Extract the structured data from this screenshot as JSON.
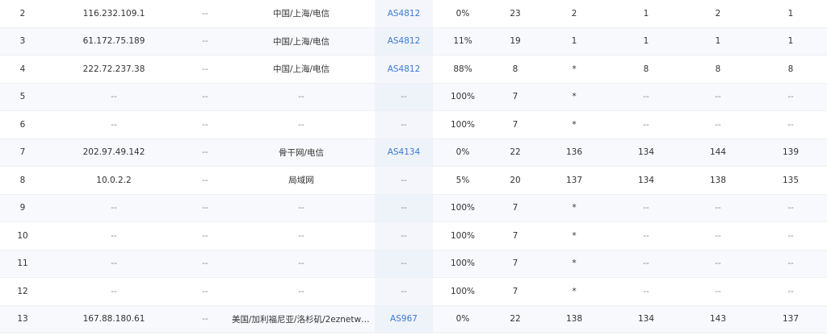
{
  "rows": [
    {
      "hop": "2",
      "ip": "116.232.109.1",
      "host": "--",
      "location": "中国/上海/电信",
      "asn": "AS4812",
      "loss": "0%",
      "sent": "23",
      "last": "2",
      "avg": "1",
      "best": "2",
      "worst": "1"
    },
    {
      "hop": "3",
      "ip": "61.172.75.189",
      "host": "--",
      "location": "中国/上海/电信",
      "asn": "AS4812",
      "loss": "11%",
      "sent": "19",
      "last": "1",
      "avg": "1",
      "best": "1",
      "worst": "1"
    },
    {
      "hop": "4",
      "ip": "222.72.237.38",
      "host": "--",
      "location": "中国/上海/电信",
      "asn": "AS4812",
      "loss": "88%",
      "sent": "8",
      "last": "*",
      "avg": "8",
      "best": "8",
      "worst": "8"
    },
    {
      "hop": "5",
      "ip": "--",
      "host": "--",
      "location": "--",
      "asn": "--",
      "loss": "100%",
      "sent": "7",
      "last": "*",
      "avg": "--",
      "best": "--",
      "worst": "--"
    },
    {
      "hop": "6",
      "ip": "--",
      "host": "--",
      "location": "--",
      "asn": "--",
      "loss": "100%",
      "sent": "7",
      "last": "*",
      "avg": "--",
      "best": "--",
      "worst": "--"
    },
    {
      "hop": "7",
      "ip": "202.97.49.142",
      "host": "--",
      "location": "骨干网/电信",
      "asn": "AS4134",
      "loss": "0%",
      "sent": "22",
      "last": "136",
      "avg": "134",
      "best": "144",
      "worst": "139"
    },
    {
      "hop": "8",
      "ip": "10.0.2.2",
      "host": "--",
      "location": "局域网",
      "asn": "--",
      "loss": "5%",
      "sent": "20",
      "last": "137",
      "avg": "134",
      "best": "138",
      "worst": "135"
    },
    {
      "hop": "9",
      "ip": "--",
      "host": "--",
      "location": "--",
      "asn": "--",
      "loss": "100%",
      "sent": "7",
      "last": "*",
      "avg": "--",
      "best": "--",
      "worst": "--"
    },
    {
      "hop": "10",
      "ip": "--",
      "host": "--",
      "location": "--",
      "asn": "--",
      "loss": "100%",
      "sent": "7",
      "last": "*",
      "avg": "--",
      "best": "--",
      "worst": "--"
    },
    {
      "hop": "11",
      "ip": "--",
      "host": "--",
      "location": "--",
      "asn": "--",
      "loss": "100%",
      "sent": "7",
      "last": "*",
      "avg": "--",
      "best": "--",
      "worst": "--"
    },
    {
      "hop": "12",
      "ip": "--",
      "host": "--",
      "location": "--",
      "asn": "--",
      "loss": "100%",
      "sent": "7",
      "last": "*",
      "avg": "--",
      "best": "--",
      "worst": "--"
    },
    {
      "hop": "13",
      "ip": "167.88.180.61",
      "host": "--",
      "location": "美国/加利福尼亚/洛杉矶/2eznetwo...",
      "asn": "AS967",
      "loss": "0%",
      "sent": "22",
      "last": "138",
      "avg": "134",
      "best": "143",
      "worst": "137"
    }
  ],
  "colors": {
    "link": "#3a7bd5",
    "alt_row": "#f8f9fc",
    "border": "#eef0f3"
  }
}
